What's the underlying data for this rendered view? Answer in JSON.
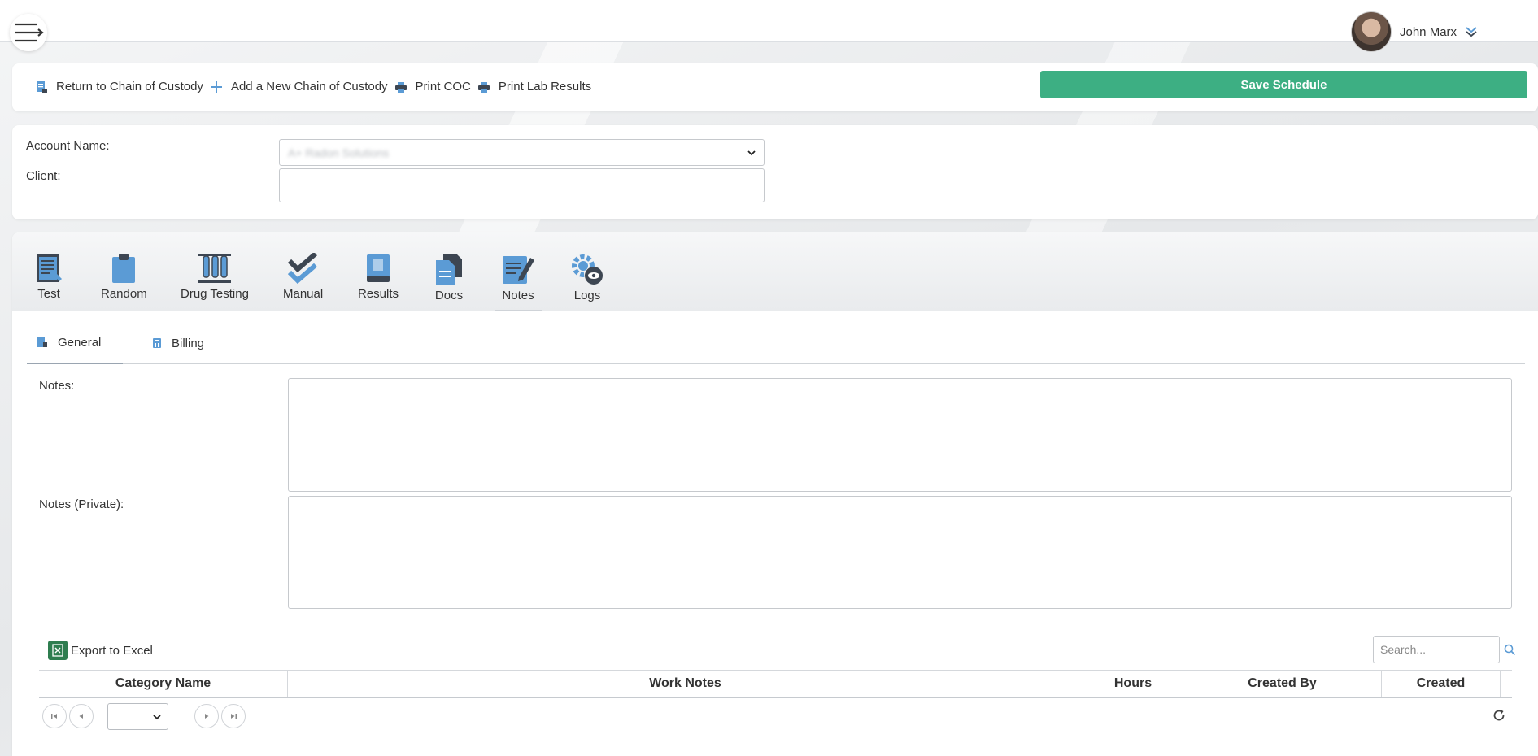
{
  "user": {
    "name": "John Marx"
  },
  "toolbar": {
    "items": [
      {
        "label": "Return to Chain of Custody",
        "icon": "document-return-icon"
      },
      {
        "label": "Add a New Chain of Custody",
        "icon": "plus-icon"
      },
      {
        "label": "Print COC",
        "icon": "printer-icon"
      },
      {
        "label": "Print Lab Results",
        "icon": "printer-icon"
      }
    ],
    "save_label": "Save Schedule"
  },
  "account": {
    "account_label": "Account Name:",
    "account_value": "A+ Radon Solutions",
    "client_label": "Client:",
    "client_value": ""
  },
  "modules": [
    {
      "label": "Test",
      "icon": "test-form-icon"
    },
    {
      "label": "Random",
      "icon": "clipboard-icon"
    },
    {
      "label": "Drug Testing",
      "icon": "test-tubes-icon"
    },
    {
      "label": "Manual",
      "icon": "checkmark-icon"
    },
    {
      "label": "Results",
      "icon": "book-icon"
    },
    {
      "label": "Docs",
      "icon": "documents-icon"
    },
    {
      "label": "Notes",
      "icon": "notes-pencil-icon"
    },
    {
      "label": "Logs",
      "icon": "gear-eye-icon"
    }
  ],
  "subtabs": [
    {
      "label": "General",
      "icon": "general-icon"
    },
    {
      "label": "Billing",
      "icon": "calculator-icon"
    }
  ],
  "notes": {
    "notes_label": "Notes:",
    "private_label": "Notes (Private):"
  },
  "grid": {
    "export_label": "Export to Excel",
    "search_placeholder": "Search...",
    "columns": [
      "Category Name",
      "Work Notes",
      "Hours",
      "Created By",
      "Created"
    ]
  },
  "colors": {
    "accent_green": "#3daf83",
    "icon_blue": "#5b9bd5",
    "icon_dark": "#3d4652"
  }
}
